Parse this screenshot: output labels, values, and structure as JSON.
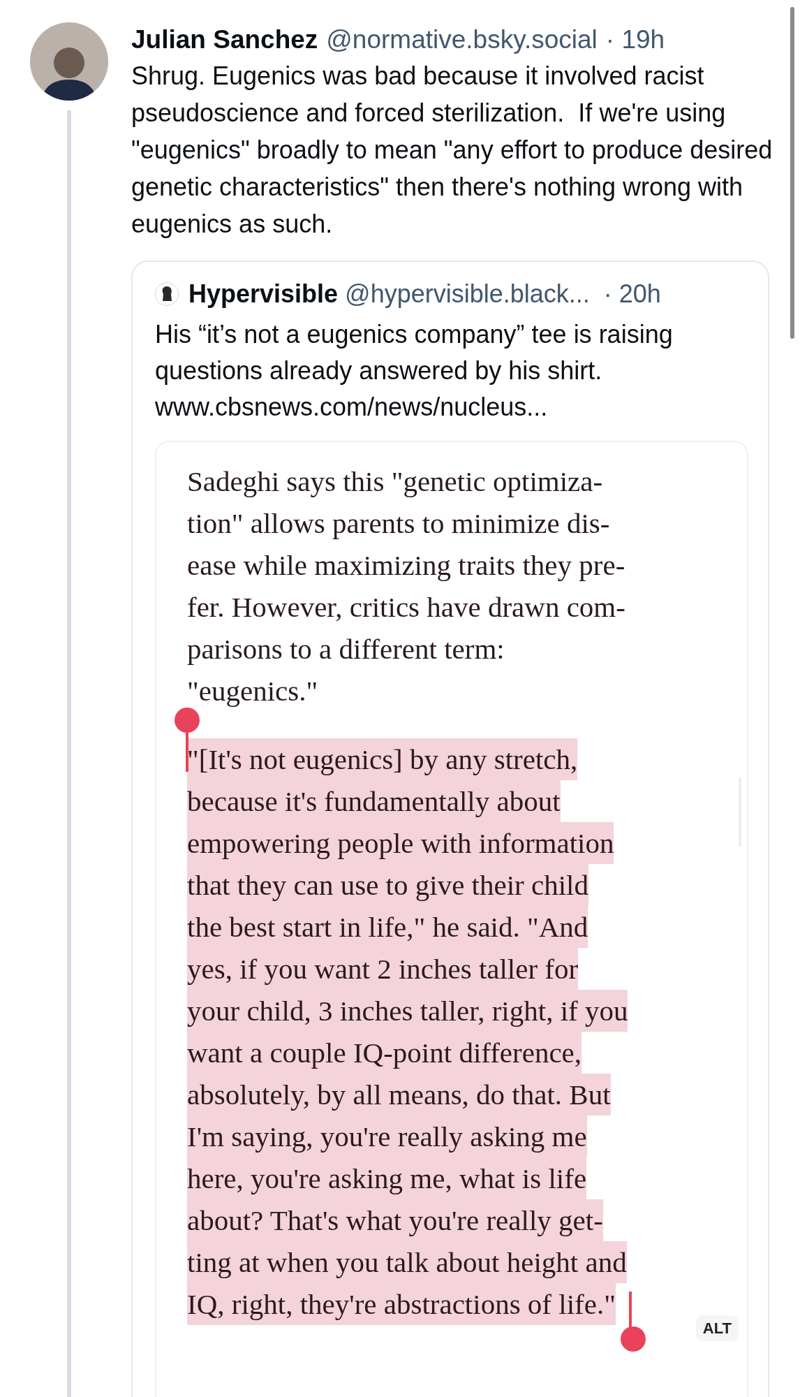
{
  "post": {
    "author": "Julian Sanchez",
    "handle": "@normative.bsky.social",
    "time": "· 19h",
    "text": "Shrug. Eugenics was bad because it involved racist pseudoscience and forced sterilization.  If we're using \"eugenics\" broadly to mean \"any effort to produce desired genetic characteristics\" then there's nothing wrong with eugenics as such."
  },
  "quote": {
    "author": "Hypervisible",
    "handle": "@hypervisible.black...",
    "time": "· 20h",
    "text": "His “it’s not a eugenics company” tee is raising questions already answered by his shirt. www.cbsnews.com/news/nucleus..."
  },
  "image": {
    "alt_badge": "ALT",
    "paragraphs": [
      {
        "highlighted": false,
        "lines": [
          "Sadeghi says this \"genetic optimiza-",
          "tion\" allows parents to minimize dis-",
          "ease while maximizing traits they pre-",
          "fer. However, critics have drawn com-",
          "parisons to a different term:",
          "\"eugenics.\""
        ]
      },
      {
        "highlighted": true,
        "lines": [
          "\"[It's not eugenics] by any stretch,",
          "because it's fundamentally about",
          "empowering people with information",
          "that they can use to give their child",
          "the best start in life,\" he said. \"And",
          "yes, if you want 2 inches taller for",
          "your child, 3 inches taller, right, if you",
          "want a couple IQ-point difference,",
          "absolutely, by all means, do that. But",
          "I'm saying, you're really asking me",
          "here, you're asking me, what is life",
          "about? That's what you're really get-",
          "ting at when you talk about height and",
          "IQ, right, they're abstractions of life.\""
        ]
      }
    ]
  }
}
